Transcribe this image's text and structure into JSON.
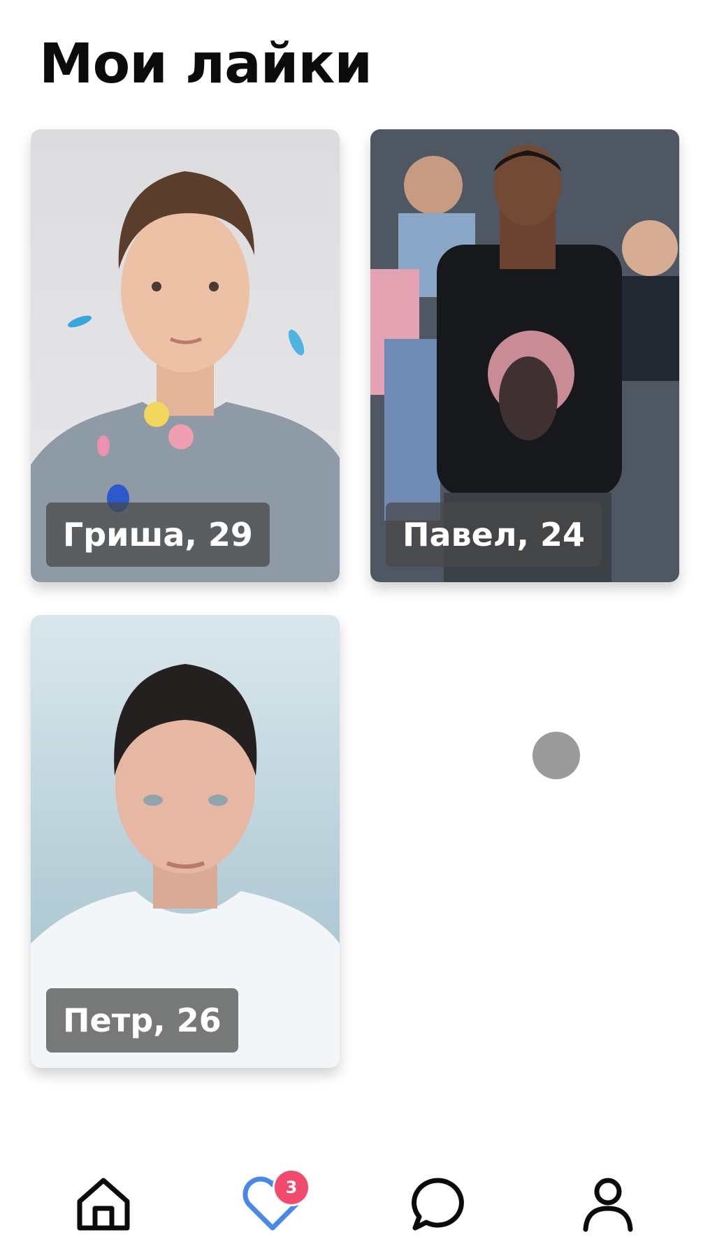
{
  "page": {
    "title": "Мои лайки"
  },
  "likes": [
    {
      "name_age": "Гриша, 29"
    },
    {
      "name_age": "Павел, 24"
    },
    {
      "name_age": "Петр, 26"
    }
  ],
  "nav": {
    "items": [
      "home-icon",
      "heart-icon",
      "chat-icon",
      "profile-icon"
    ],
    "active": "heart-icon",
    "likes_badge": "3"
  },
  "colors": {
    "accent": "#4a88e8",
    "badge": "#f04a6d",
    "label_bg": "#464646"
  }
}
